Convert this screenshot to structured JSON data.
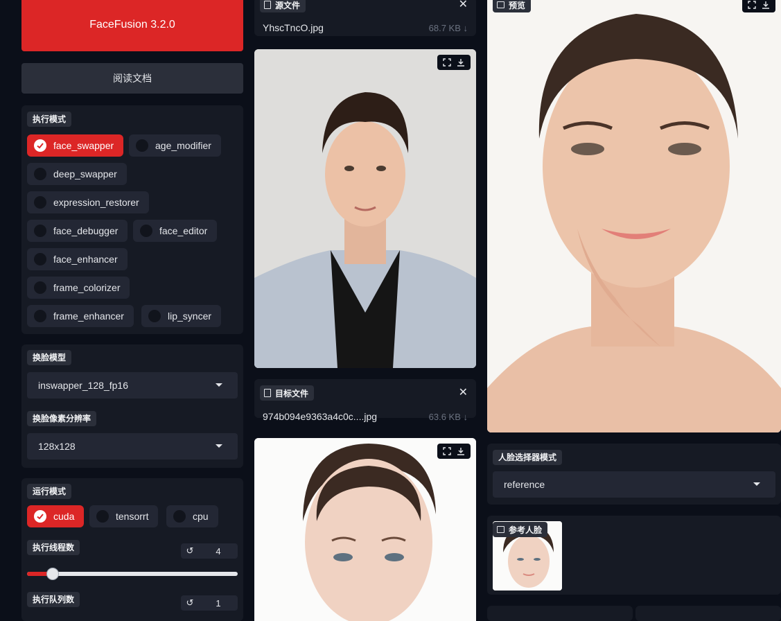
{
  "app": {
    "title": "FaceFusion 3.2.0",
    "docs_label": "阅读文档"
  },
  "processors": {
    "label": "执行模式",
    "items": [
      {
        "label": "face_swapper",
        "checked": true
      },
      {
        "label": "age_modifier",
        "checked": false
      },
      {
        "label": "deep_swapper",
        "checked": false
      },
      {
        "label": "expression_restorer",
        "checked": false
      },
      {
        "label": "face_debugger",
        "checked": false
      },
      {
        "label": "face_editor",
        "checked": false
      },
      {
        "label": "face_enhancer",
        "checked": false
      },
      {
        "label": "frame_colorizer",
        "checked": false
      },
      {
        "label": "frame_enhancer",
        "checked": false
      },
      {
        "label": "lip_syncer",
        "checked": false
      }
    ]
  },
  "face_swapper": {
    "model_label": "换脸模型",
    "model_value": "inswapper_128_fp16",
    "resolution_label": "换脸像素分辨率",
    "resolution_value": "128x128"
  },
  "execution": {
    "label": "运行模式",
    "providers": [
      {
        "label": "cuda",
        "checked": true
      },
      {
        "label": "tensorrt",
        "checked": false
      },
      {
        "label": "cpu",
        "checked": false
      }
    ],
    "threads_label": "执行线程数",
    "threads_value": "4",
    "threads_fraction": 0.12,
    "queue_label": "执行队列数",
    "queue_value": "1",
    "reset_glyph": "↺"
  },
  "source": {
    "label": "源文件",
    "filename": "YhscTncO.jpg",
    "size": "68.7 KB ↓",
    "close": "✕"
  },
  "target": {
    "label": "目标文件",
    "filename": "974b094e9363a4c0c....jpg",
    "size": "63.6 KB ↓",
    "close": "✕"
  },
  "preview": {
    "label": "预览"
  },
  "face_selector": {
    "label": "人脸选择器模式",
    "value": "reference"
  },
  "reference_face": {
    "label": "参考人脸"
  },
  "colors": {
    "accent": "#dc2626",
    "panel": "#161a24",
    "background": "#0b0f19"
  }
}
